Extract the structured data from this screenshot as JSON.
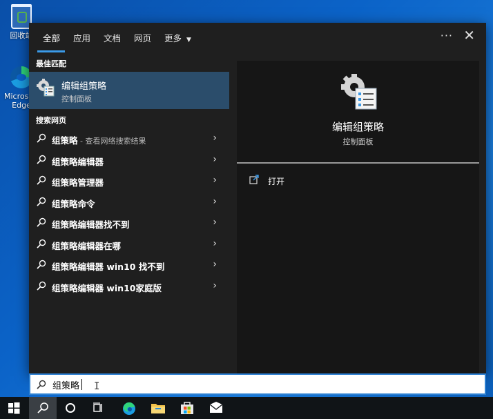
{
  "desktop": {
    "icons": [
      {
        "label": "回收站",
        "icon": "recycle-bin-icon"
      },
      {
        "label": "Microsoft Edge",
        "icon": "edge-icon"
      }
    ]
  },
  "search_panel": {
    "tabs": [
      {
        "label": "全部",
        "active": true
      },
      {
        "label": "应用",
        "active": false
      },
      {
        "label": "文档",
        "active": false
      },
      {
        "label": "网页",
        "active": false
      },
      {
        "label": "更多",
        "active": false,
        "dropdown": true
      }
    ],
    "more_options_label": "···",
    "close_label": "✕",
    "best_match": {
      "heading": "最佳匹配",
      "title": "编辑组策略",
      "subtitle": "控制面板"
    },
    "web_search": {
      "heading": "搜索网页",
      "items": [
        {
          "label": "组策略",
          "suffix": " - 查看网络搜索结果"
        },
        {
          "label": "组策略编辑器",
          "suffix": ""
        },
        {
          "label": "组策略管理器",
          "suffix": ""
        },
        {
          "label": "组策略命令",
          "suffix": ""
        },
        {
          "label": "组策略编辑器找不到",
          "suffix": ""
        },
        {
          "label": "组策略编辑器在哪",
          "suffix": ""
        },
        {
          "label": "组策略编辑器 win10 找不到",
          "suffix": ""
        },
        {
          "label": "组策略编辑器 win10家庭版",
          "suffix": ""
        }
      ]
    },
    "preview": {
      "title": "编辑组策略",
      "subtitle": "控制面板",
      "actions": [
        {
          "label": "打开",
          "icon": "open-icon"
        }
      ]
    }
  },
  "search": {
    "value": "组策略",
    "placeholder": ""
  },
  "taskbar": {
    "items": [
      "windows-start-icon",
      "search-icon",
      "cortana-icon",
      "task-view-icon",
      "edge-icon",
      "file-explorer-icon",
      "store-icon",
      "mail-icon"
    ]
  },
  "colors": {
    "accent": "#3b9ae8",
    "selected_row": "#2b4d6b",
    "panel_bg": "#1f1f1f",
    "preview_bg": "#161616"
  }
}
